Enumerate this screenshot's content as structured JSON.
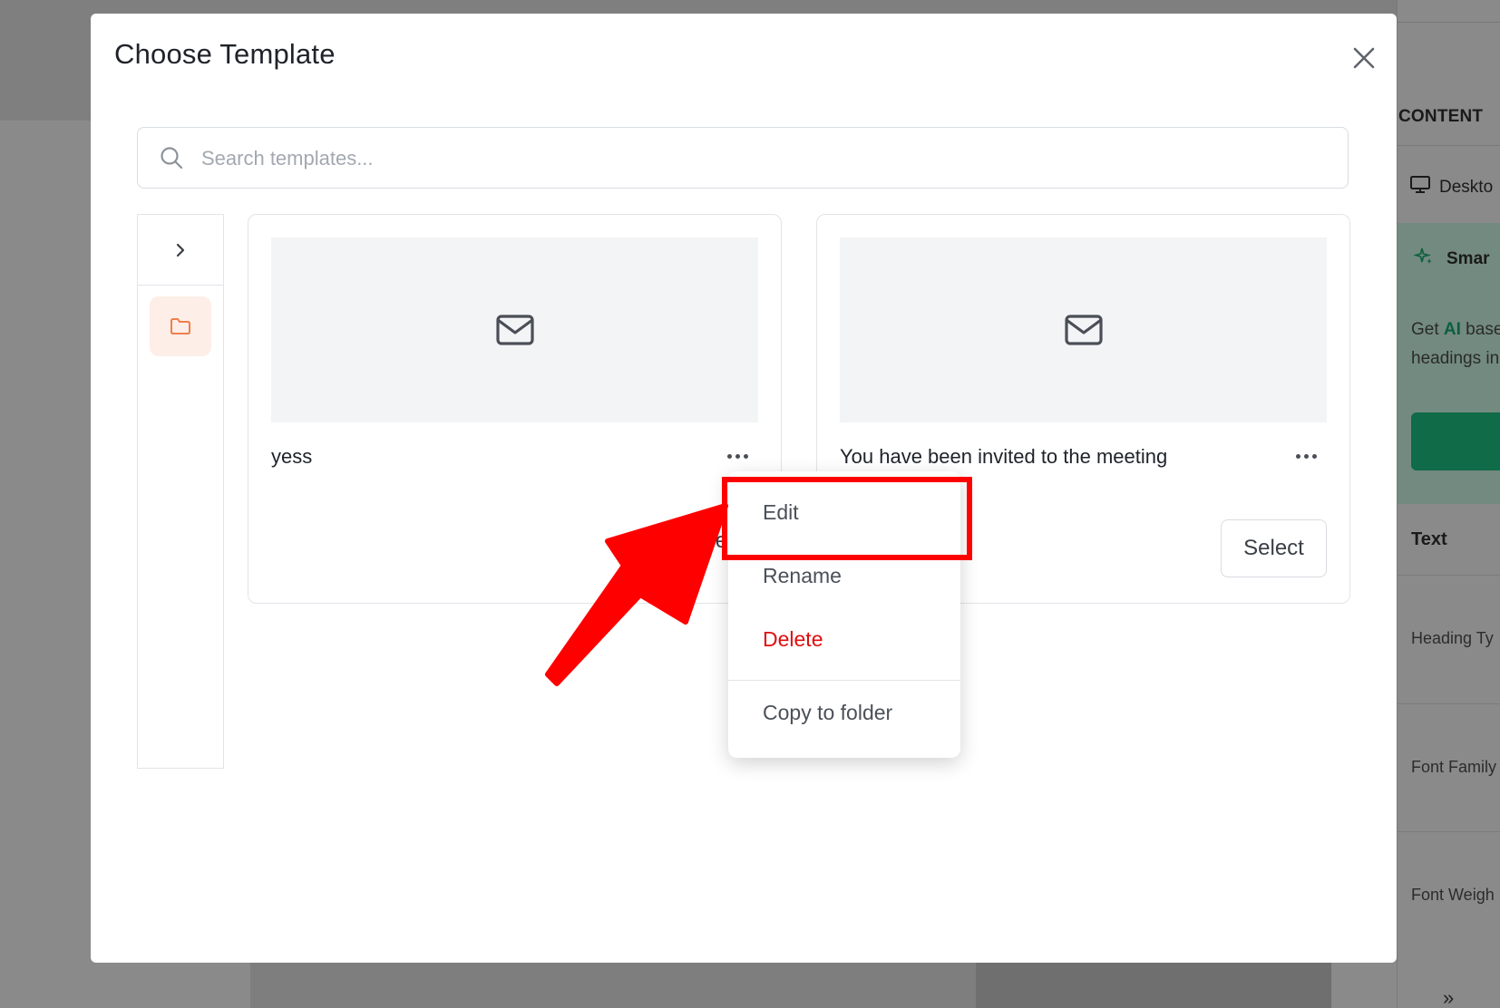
{
  "modal": {
    "title": "Choose Template",
    "search_placeholder": "Search templates..."
  },
  "cards": [
    {
      "name": "yess",
      "select_label": "Select"
    },
    {
      "name": "You have been invited to the meeting",
      "select_label": "Select"
    }
  ],
  "context_menu": {
    "items": [
      "Edit",
      "Rename",
      "Delete",
      "Copy to folder"
    ]
  },
  "background_panel": {
    "tab": "CONTENT",
    "device": "Deskto",
    "smart": "Smar",
    "ai_line1_prefix": "Get ",
    "ai_line1_bold": "AI",
    "ai_line1_suffix": " base",
    "ai_line2": "headings in",
    "section": "Text",
    "rows": [
      "Heading Ty",
      "Font Family",
      "Font Weigh"
    ],
    "bottom_glyph": "»"
  },
  "colors": {
    "annotation": "#ff0000",
    "delete": "#e00d0d",
    "folder_accent": "#f07f4a",
    "ai_green": "#0f6b48"
  },
  "icons": [
    "search-icon",
    "close-icon",
    "chevron-right-icon",
    "folder-icon",
    "mail-icon",
    "more-horizontal-icon",
    "desktop-icon",
    "sparkle-icon"
  ]
}
